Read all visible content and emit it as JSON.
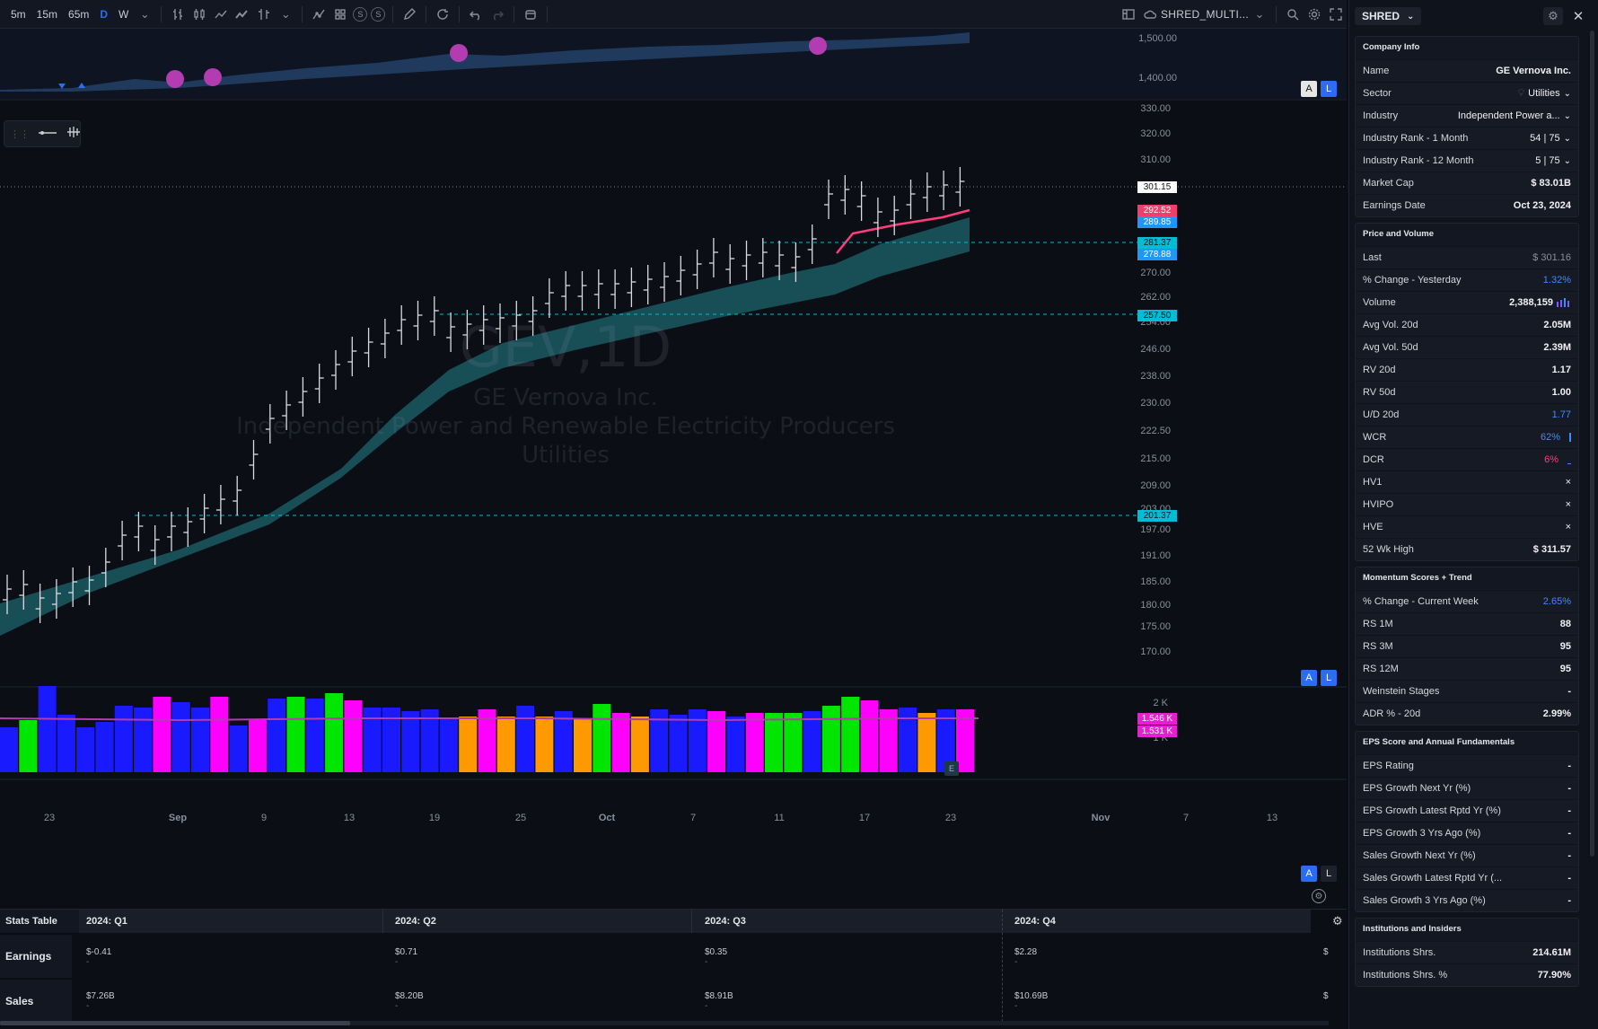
{
  "toolbar": {
    "intervals": [
      "5m",
      "15m",
      "65m",
      "D",
      "W"
    ],
    "active_interval": "D",
    "compare_s1": "S",
    "compare_s2": "S",
    "layout_name": "SHRED_MULTI..."
  },
  "chart": {
    "watermark_title": "GEV,1D",
    "watermark_company": "GE Vernova Inc.",
    "watermark_industry": "Independent Power and Renewable Electricity Producers",
    "watermark_sector": "Utilities",
    "top_pane_labels": [
      "1,500.00",
      "1,400.00"
    ],
    "price_axis": [
      "330.00",
      "320.00",
      "310.00",
      "270.00",
      "262.00",
      "254.00",
      "246.00",
      "238.00",
      "230.00",
      "222.50",
      "215.00",
      "209.00",
      "203.00",
      "197.00",
      "191.00",
      "185.00",
      "180.00",
      "175.00",
      "170.00"
    ],
    "price_tags": [
      {
        "label": "301.15",
        "bg": "#ffffff",
        "fg": "#111111"
      },
      {
        "label": "292.52",
        "bg": "#f23d6d",
        "fg": "#ffffff"
      },
      {
        "label": "289.85",
        "bg": "#2196f3",
        "fg": "#ffffff"
      },
      {
        "label": "281.37",
        "bg": "#00bcd4",
        "fg": "#0b0e14"
      },
      {
        "label": "278.88",
        "bg": "#2196f3",
        "fg": "#ffffff"
      },
      {
        "label": "257.50",
        "bg": "#00bcd4",
        "fg": "#0b0e14"
      },
      {
        "label": "201.37",
        "bg": "#00bcd4",
        "fg": "#0b0e14"
      }
    ],
    "volume_axis": [
      "2 K",
      "1 K"
    ],
    "volume_tags": [
      {
        "label": "1.546 K",
        "bg": "#e91ed4"
      },
      {
        "label": "1.531 K",
        "bg": "#e91ed4"
      }
    ],
    "earnings_marker": "E",
    "time_axis": [
      "23",
      "Sep",
      "9",
      "13",
      "19",
      "25",
      "Oct",
      "7",
      "11",
      "17",
      "23",
      "Nov",
      "7",
      "13"
    ],
    "btn_a": "A",
    "btn_l": "L"
  },
  "stats": {
    "title": "Stats Table",
    "quarters": [
      "2024: Q1",
      "2024: Q2",
      "2024: Q3",
      "2024: Q4"
    ],
    "rows": [
      {
        "label": "Earnings",
        "values": [
          "$-0.41",
          "$0.71",
          "$0.35",
          "$2.28"
        ],
        "sub": [
          "-",
          "-",
          "-",
          "-"
        ]
      },
      {
        "label": "Sales",
        "values": [
          "$7.26B",
          "$8.20B",
          "$8.91B",
          "$10.69B"
        ],
        "sub": [
          "-",
          "-",
          "-",
          "-"
        ]
      }
    ],
    "dollar": "$"
  },
  "panel": {
    "layout_select": "SHRED",
    "company_info": {
      "title": "Company Info",
      "rows": [
        {
          "label": "Name",
          "value": "GE Vernova Inc."
        },
        {
          "label": "Sector",
          "value": "Utilities"
        },
        {
          "label": "Industry",
          "value": "Independent Power a..."
        },
        {
          "label": "Industry Rank - 1 Month",
          "value": "54 | 75"
        },
        {
          "label": "Industry Rank - 12 Month",
          "value": "5 | 75"
        },
        {
          "label": "Market Cap",
          "value": "$ 83.01B"
        },
        {
          "label": "Earnings Date",
          "value": "Oct 23, 2024"
        }
      ]
    },
    "price_volume": {
      "title": "Price and Volume",
      "rows": [
        {
          "label": "Last",
          "value": "$ 301.16"
        },
        {
          "label": "% Change - Yesterday",
          "value": "1.32%"
        },
        {
          "label": "Volume",
          "value": "2,388,159"
        },
        {
          "label": "Avg Vol. 20d",
          "value": "2.05M"
        },
        {
          "label": "Avg Vol. 50d",
          "value": "2.39M"
        },
        {
          "label": "RV 20d",
          "value": "1.17"
        },
        {
          "label": "RV 50d",
          "value": "1.00"
        },
        {
          "label": "U/D 20d",
          "value": "1.77"
        },
        {
          "label": "WCR",
          "value": "62%"
        },
        {
          "label": "DCR",
          "value": "6%"
        },
        {
          "label": "HV1",
          "value": "×"
        },
        {
          "label": "HVIPO",
          "value": "×"
        },
        {
          "label": "HVE",
          "value": "×"
        },
        {
          "label": "52 Wk High",
          "value": "$ 311.57"
        }
      ]
    },
    "momentum": {
      "title": "Momentum Scores + Trend",
      "rows": [
        {
          "label": "% Change - Current Week",
          "value": "2.65%"
        },
        {
          "label": "RS 1M",
          "value": "88"
        },
        {
          "label": "RS 3M",
          "value": "95"
        },
        {
          "label": "RS 12M",
          "value": "95"
        },
        {
          "label": "Weinstein Stages",
          "value": "-"
        },
        {
          "label": "ADR % - 20d",
          "value": "2.99%"
        }
      ]
    },
    "eps": {
      "title": "EPS Score and Annual Fundamentals",
      "rows": [
        {
          "label": "EPS Rating",
          "value": "-"
        },
        {
          "label": "EPS Growth Next Yr (%)",
          "value": "-"
        },
        {
          "label": "EPS Growth Latest Rptd Yr (%)",
          "value": "-"
        },
        {
          "label": "EPS Growth 3 Yrs Ago (%)",
          "value": "-"
        },
        {
          "label": "Sales Growth Next Yr (%)",
          "value": "-"
        },
        {
          "label": "Sales Growth Latest Rptd Yr (...",
          "value": "-"
        },
        {
          "label": "Sales Growth 3 Yrs Ago (%)",
          "value": "-"
        }
      ]
    },
    "institutions": {
      "title": "Institutions and Insiders",
      "rows": [
        {
          "label": "Institutions Shrs.",
          "value": "214.61M"
        },
        {
          "label": "Institutions Shrs. %",
          "value": "77.90%"
        }
      ]
    }
  }
}
